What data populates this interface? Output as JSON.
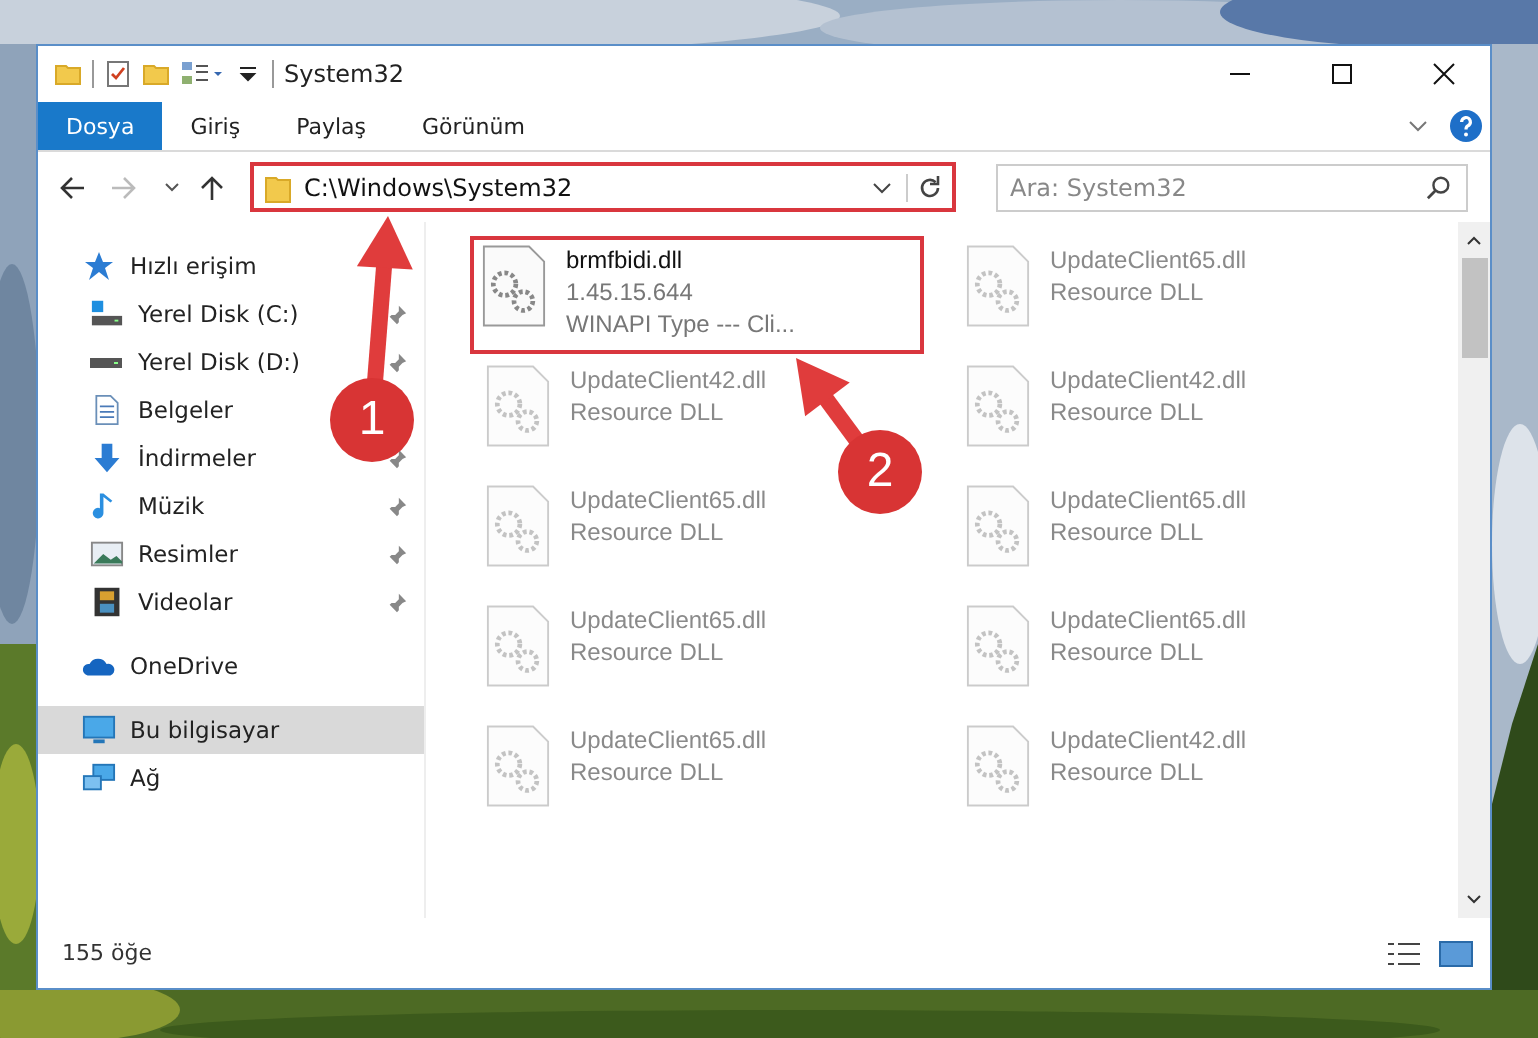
{
  "window": {
    "title": "System32"
  },
  "ribbon": {
    "tabs": [
      {
        "label": "Dosya",
        "selected": true
      },
      {
        "label": "Giriş",
        "selected": false
      },
      {
        "label": "Paylaş",
        "selected": false
      },
      {
        "label": "Görünüm",
        "selected": false
      }
    ]
  },
  "address_bar": {
    "path": "C:\\Windows\\System32",
    "highlighted": true
  },
  "search": {
    "placeholder": "Ara: System32"
  },
  "sidebar": {
    "items": [
      {
        "label": "Hızlı erişim",
        "kind": "star",
        "selected": false,
        "children": [
          {
            "label": "Yerel Disk (C:)",
            "kind": "drive-c",
            "pinned": true,
            "selected": false
          },
          {
            "label": "Yerel Disk (D:)",
            "kind": "drive",
            "pinned": true,
            "selected": false
          },
          {
            "label": "Belgeler",
            "kind": "docs",
            "selected": false
          },
          {
            "label": "İndirmeler",
            "kind": "download",
            "pinned": true,
            "selected": false
          },
          {
            "label": "Müzik",
            "kind": "music",
            "pinned": true,
            "selected": false
          },
          {
            "label": "Resimler",
            "kind": "pictures",
            "pinned": true,
            "selected": false
          },
          {
            "label": "Videolar",
            "kind": "videos",
            "pinned": true,
            "selected": false
          }
        ]
      },
      {
        "label": "OneDrive",
        "kind": "cloud",
        "selected": false
      },
      {
        "label": "Bu bilgisayar",
        "kind": "pc",
        "selected": true
      },
      {
        "label": "Ağ",
        "kind": "network",
        "selected": false
      }
    ]
  },
  "files": [
    {
      "name": "brmfbidi.dll",
      "details": [
        "1.45.15.644",
        "WINAPI Type --- Cli..."
      ],
      "dimmed": false,
      "highlighted": true
    },
    {
      "name": "UpdateClient65.dll",
      "details": [
        "Resource DLL"
      ],
      "dimmed": true,
      "highlighted": false
    },
    {
      "name": "UpdateClient42.dll",
      "details": [
        "Resource DLL"
      ],
      "dimmed": true,
      "highlighted": false
    },
    {
      "name": "UpdateClient42.dll",
      "details": [
        "Resource DLL"
      ],
      "dimmed": true,
      "highlighted": false
    },
    {
      "name": "UpdateClient65.dll",
      "details": [
        "Resource DLL"
      ],
      "dimmed": true,
      "highlighted": false
    },
    {
      "name": "UpdateClient65.dll",
      "details": [
        "Resource DLL"
      ],
      "dimmed": true,
      "highlighted": false
    },
    {
      "name": "UpdateClient65.dll",
      "details": [
        "Resource DLL"
      ],
      "dimmed": true,
      "highlighted": false
    },
    {
      "name": "UpdateClient65.dll",
      "details": [
        "Resource DLL"
      ],
      "dimmed": true,
      "highlighted": false
    },
    {
      "name": "UpdateClient65.dll",
      "details": [
        "Resource DLL"
      ],
      "dimmed": true,
      "highlighted": false
    },
    {
      "name": "UpdateClient42.dll",
      "details": [
        "Resource DLL"
      ],
      "dimmed": true,
      "highlighted": false
    }
  ],
  "status_bar": {
    "count": "155 öğe"
  },
  "annotations": [
    {
      "label": "1"
    },
    {
      "label": "2"
    }
  ]
}
